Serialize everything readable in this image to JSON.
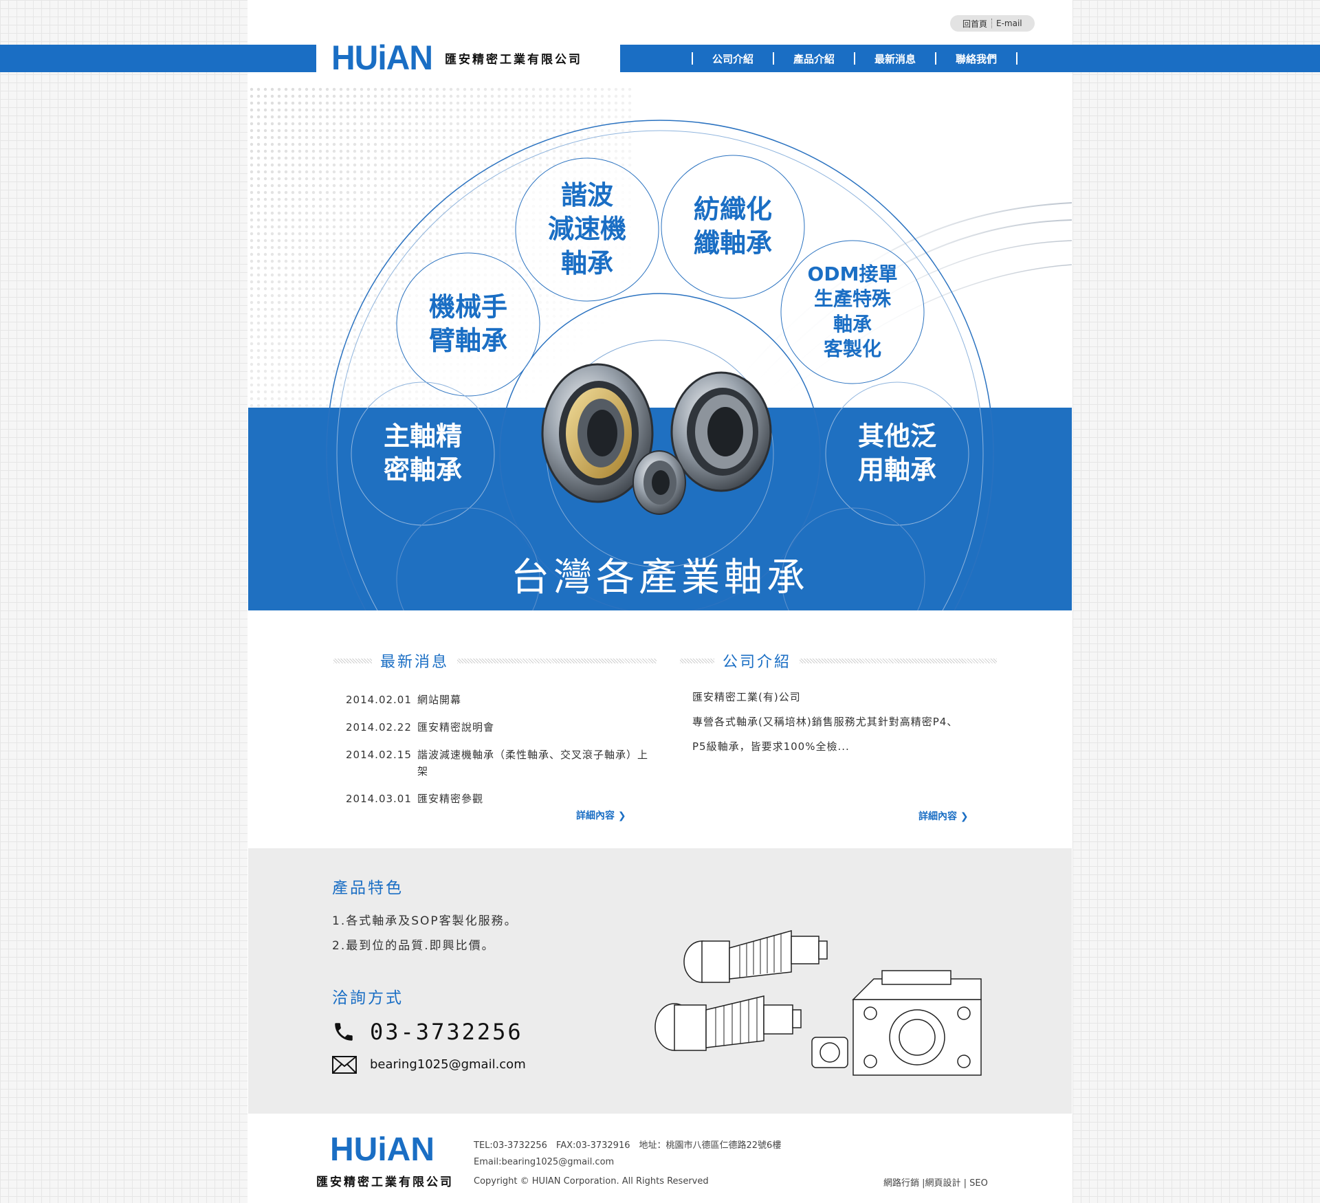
{
  "top": {
    "home": "回首頁",
    "email": "E-mail"
  },
  "brand": {
    "logo": "HUiAN",
    "name_cn": "匯安精密工業有限公司"
  },
  "nav": [
    "公司介紹",
    "產品介紹",
    "最新消息",
    "聯絡我們"
  ],
  "banner": {
    "circles": [
      {
        "label": "諧波\n減速機\n軸承"
      },
      {
        "label": "紡織化\n纖軸承"
      },
      {
        "label": "機械手\n臂軸承"
      },
      {
        "label": "ODM接單\n生產特殊\n軸承\n客製化"
      },
      {
        "label": "主軸精\n密軸承"
      },
      {
        "label": "其他泛\n用軸承"
      }
    ],
    "title": "台灣各產業軸承"
  },
  "news": {
    "title": "最新消息",
    "items": [
      {
        "date": "2014.02.01",
        "title": "網站開幕"
      },
      {
        "date": "2014.02.22",
        "title": "匯安精密說明會"
      },
      {
        "date": "2014.02.15",
        "title": "諧波減速機軸承（柔性軸承、交叉滾子軸承）上架"
      },
      {
        "date": "2014.03.01",
        "title": "匯安精密參觀"
      }
    ],
    "more": "詳細內容"
  },
  "about": {
    "title": "公司介紹",
    "lines": [
      "匯安精密工業(有)公司",
      "專營各式軸承(又稱培林)銷售服務尤其針對高精密P4、",
      "P5級軸承，皆要求100%全檢..."
    ],
    "more": "詳細內容"
  },
  "features": {
    "title": "產品特色",
    "items": [
      "1.各式軸承及SOP客製化服務。",
      "2.最到位的品質.即興比價。"
    ],
    "contact_title": "洽詢方式",
    "phone": "03-3732256",
    "email": "bearing1025@gmail.com"
  },
  "footer": {
    "logo": "HUiAN",
    "name_cn": "匯安精密工業有限公司",
    "line1": "TEL:03-3732256　FAX:03-3732916　地址：桃園市八德區仁德路22號6樓",
    "line2": "Email:bearing1025@gmail.com",
    "copyright": "Copyright © HUIAN Corporation. All Rights Reserved",
    "links": "網路行銷 |網頁設計 | SEO"
  },
  "colors": {
    "brand_blue": "#1a6ec4",
    "banner_blue": "#1f70c1",
    "feature_bg": "#ececec"
  }
}
